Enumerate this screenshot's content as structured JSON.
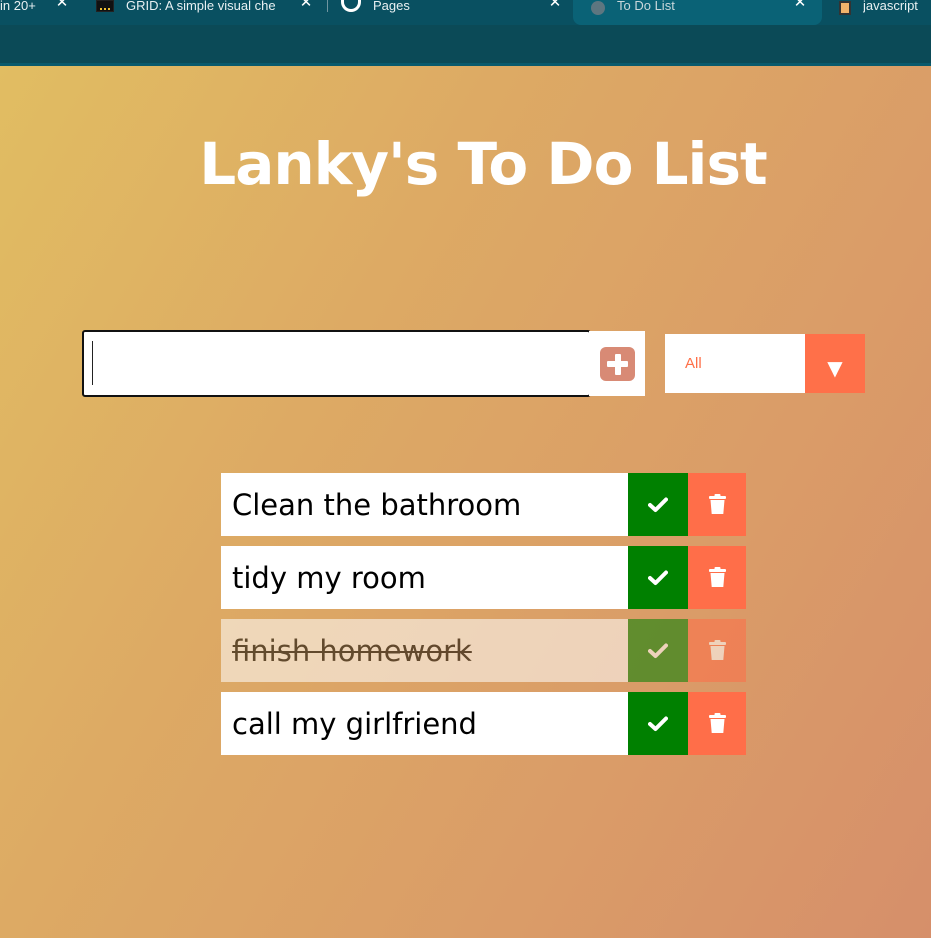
{
  "browser": {
    "tabs": [
      {
        "label": "in 20+"
      },
      {
        "label": "GRID: A simple visual che"
      },
      {
        "label": "Pages"
      },
      {
        "label": "To Do List"
      },
      {
        "label": "javascript"
      }
    ]
  },
  "app": {
    "title": "Lanky's To Do List",
    "input": {
      "value": "",
      "placeholder": ""
    },
    "filter": {
      "selected": "All",
      "options": [
        "All"
      ]
    },
    "todos": [
      {
        "text": "Clean the bathroom",
        "completed": false
      },
      {
        "text": "tidy my room",
        "completed": false
      },
      {
        "text": "finish homework",
        "completed": true
      },
      {
        "text": "call my girlfriend",
        "completed": false
      }
    ]
  },
  "colors": {
    "accent": "#ff6f47",
    "complete": "#008000",
    "title": "#ffffff",
    "browser_chrome": "#095061"
  },
  "icons": {
    "add": "plus-square-icon",
    "complete": "check-icon",
    "delete": "trash-icon",
    "filter": "caret-down-icon"
  }
}
